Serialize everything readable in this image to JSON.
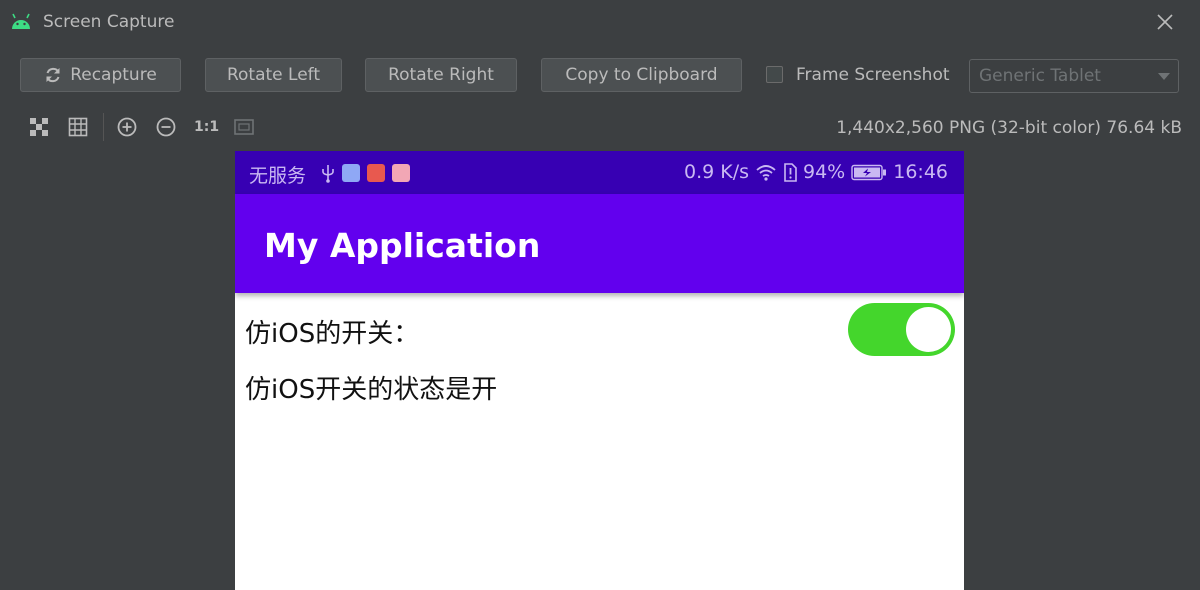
{
  "window": {
    "title": "Screen Capture"
  },
  "toolbar": {
    "recapture_label": "Recapture",
    "rotate_left_label": "Rotate Left",
    "rotate_right_label": "Rotate Right",
    "copy_label": "Copy to Clipboard",
    "frame_screenshot_label": "Frame Screenshot",
    "frame_screenshot_checked": false,
    "device_select_value": "Generic Tablet"
  },
  "viewbar": {
    "icons": [
      "checker-background-icon",
      "grid-icon",
      "zoom-in-icon",
      "zoom-out-icon",
      "actual-size-icon",
      "fit-screen-icon"
    ],
    "actual_size_label": "1:1",
    "image_info": "1,440x2,560 PNG (32-bit color) 76.64 kB"
  },
  "phone": {
    "status_bar": {
      "carrier": "无服务",
      "speed": "0.9 K/s",
      "battery": "94%",
      "time": "16:46"
    },
    "app_title": "My Application",
    "switch_label": "仿iOS的开关：",
    "switch_on": true,
    "status_text": "仿iOS开关的状态是开"
  },
  "colors": {
    "ide_background": "#3c3f41",
    "status_bar": "#3700b3",
    "app_bar": "#6200ee",
    "switch_on": "#44d62c"
  }
}
